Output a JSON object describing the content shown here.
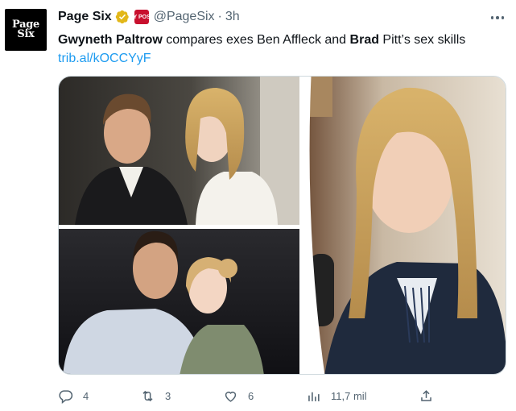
{
  "account": {
    "avatar_line1": "Page",
    "avatar_line2": "Six",
    "name": "Page Six",
    "affiliate_badge": "NY POST",
    "handle": "@PageSix",
    "separator": "·",
    "time": "3h"
  },
  "tweet": {
    "text_bold_1": "Gwyneth Paltrow",
    "text_mid": " compares exes Ben Affleck and ",
    "text_bold_2": "Brad",
    "text_end": " Pitt’s sex skills",
    "link": "trib.al/kOCCYyF"
  },
  "actions": {
    "reply_count": "4",
    "retweet_count": "3",
    "like_count": "6",
    "views_count": "11,7 mil"
  },
  "colors": {
    "accent": "#1d9bf0",
    "verified_gold": "#e2b719",
    "secondary_text": "#536471"
  }
}
